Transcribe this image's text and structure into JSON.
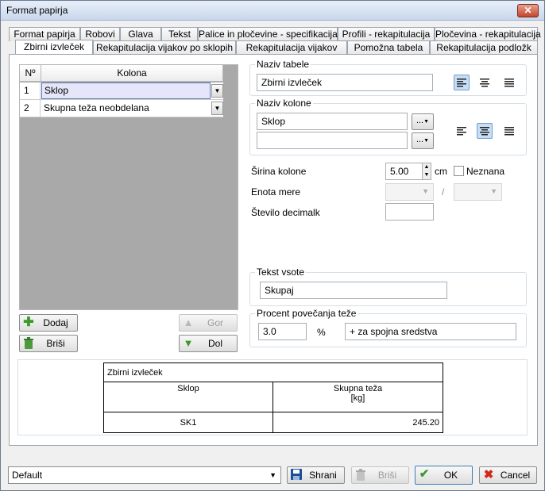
{
  "window": {
    "title": "Format papirja",
    "close_label": "✕"
  },
  "tabs_top": [
    "Format papirja",
    "Robovi",
    "Glava",
    "Tekst",
    "Palice in pločevine - specifikacija",
    "Profili - rekapitulacija",
    "Pločevina - rekapitulacija"
  ],
  "tabs_bottom": [
    "Zbirni izvleček",
    "Rekapitulacija vijakov po sklopih",
    "Rekapitulacija vijakov",
    "Pomožna tabela",
    "Rekapitulacija podložk"
  ],
  "grid": {
    "col_num": "Nº",
    "col_name": "Kolona",
    "rows": [
      {
        "num": "1",
        "value": "Sklop"
      },
      {
        "num": "2",
        "value": "Skupna teža neobdelana"
      }
    ]
  },
  "buttons": {
    "add": "Dodaj",
    "delete": "Briši",
    "up": "Gor",
    "down": "Dol"
  },
  "table_name": {
    "label": "Naziv tabele",
    "value": "Zbirni izvleček"
  },
  "column_name": {
    "label": "Naziv kolone",
    "value1": "Sklop",
    "value2": "",
    "ellipsis": "..."
  },
  "column_width": {
    "label": "Širina kolone",
    "value": "5.00",
    "unit": "cm",
    "unknown_label": "Neznana"
  },
  "unit": {
    "label": "Enota mere",
    "separator": "/"
  },
  "decimals": {
    "label": "Število decimalk",
    "value": ""
  },
  "sum_text": {
    "label": "Tekst vsote",
    "value": "Skupaj"
  },
  "weight_increase": {
    "label": "Procent povečanja teže",
    "value": "3.0",
    "unit": "%",
    "note": "+ za spojna sredstva"
  },
  "preview": {
    "title": "Zbirni izvleček",
    "headers": [
      "Sklop",
      "Skupna teža",
      "[kg]"
    ],
    "row": [
      "SK1",
      "245.20"
    ]
  },
  "footer": {
    "profile": "Default",
    "save": "Shrani",
    "delete": "Briši",
    "ok": "OK",
    "cancel": "Cancel"
  },
  "colors": {
    "accent": "#c7def5",
    "selected_row": "#e6e6fa",
    "add_icon": "#3c9a2a",
    "down_icon": "#3c9a2a",
    "close": "#c5452c"
  }
}
